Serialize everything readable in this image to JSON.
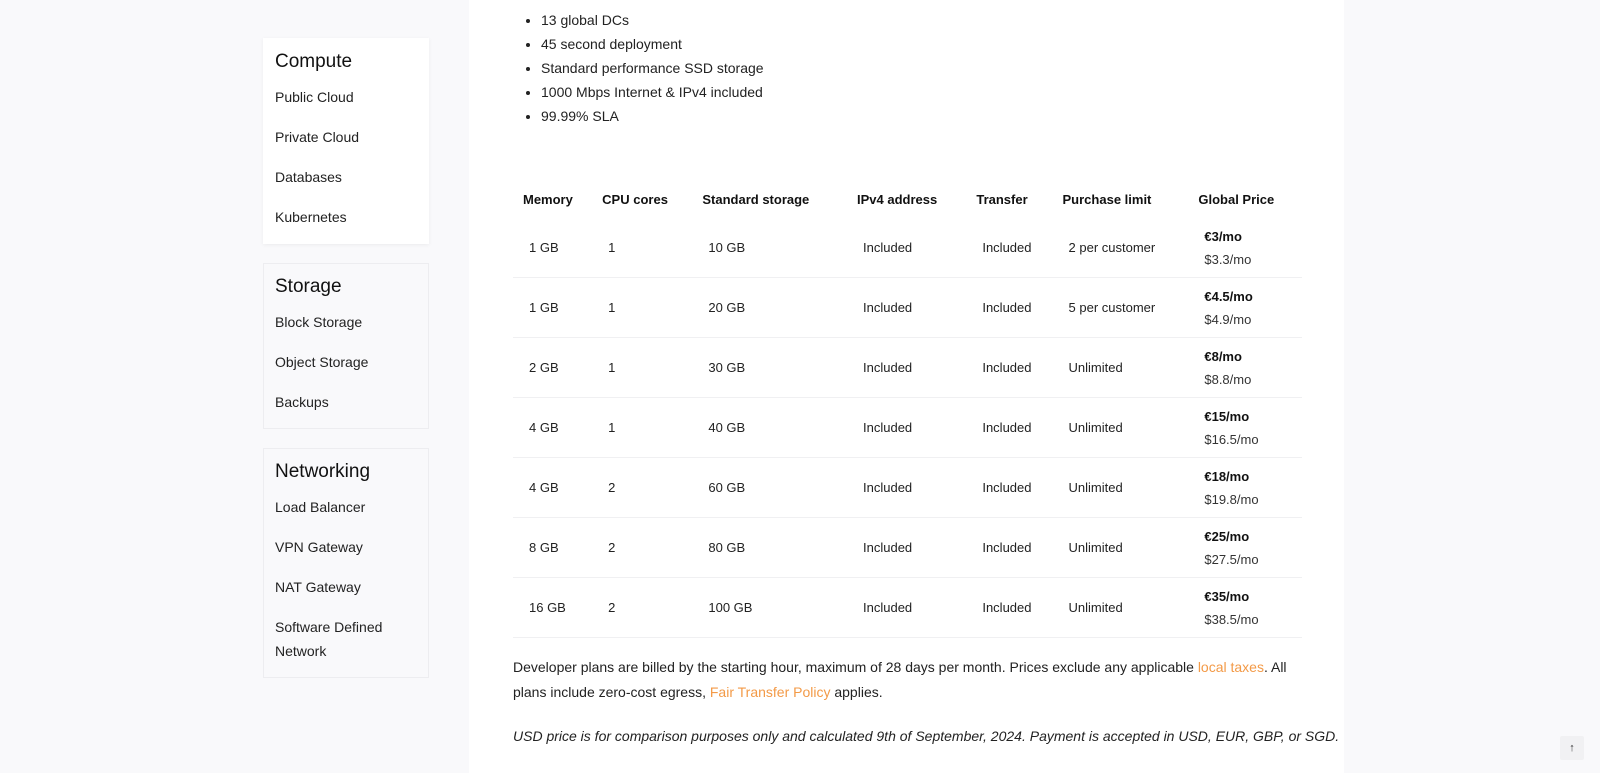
{
  "sidebar": {
    "groups": [
      {
        "title": "Compute",
        "active": true,
        "items": [
          "Public Cloud",
          "Private Cloud",
          "Databases",
          "Kubernetes"
        ]
      },
      {
        "title": "Storage",
        "active": false,
        "items": [
          "Block Storage",
          "Object Storage",
          "Backups"
        ]
      },
      {
        "title": "Networking",
        "active": false,
        "items": [
          "Load Balancer",
          "VPN Gateway",
          "NAT Gateway",
          "Software Defined Network"
        ]
      }
    ]
  },
  "features": [
    "13 global DCs",
    "45 second deployment",
    "Standard performance SSD storage",
    "1000 Mbps Internet & IPv4 included",
    "99.99% SLA"
  ],
  "table": {
    "headers": [
      "Memory",
      "CPU cores",
      "Standard storage",
      "IPv4 address",
      "Transfer",
      "Purchase limit",
      "Global Price"
    ],
    "rows": [
      {
        "memory": "1 GB",
        "cpu": "1",
        "storage": "10 GB",
        "ipv4": "Included",
        "transfer": "Included",
        "limit": "2 per customer",
        "eur": "€3/mo",
        "usd": "$3.3/mo"
      },
      {
        "memory": "1 GB",
        "cpu": "1",
        "storage": "20 GB",
        "ipv4": "Included",
        "transfer": "Included",
        "limit": "5 per customer",
        "eur": "€4.5/mo",
        "usd": "$4.9/mo"
      },
      {
        "memory": "2 GB",
        "cpu": "1",
        "storage": "30 GB",
        "ipv4": "Included",
        "transfer": "Included",
        "limit": "Unlimited",
        "eur": "€8/mo",
        "usd": "$8.8/mo"
      },
      {
        "memory": "4 GB",
        "cpu": "1",
        "storage": "40 GB",
        "ipv4": "Included",
        "transfer": "Included",
        "limit": "Unlimited",
        "eur": "€15/mo",
        "usd": "$16.5/mo"
      },
      {
        "memory": "4 GB",
        "cpu": "2",
        "storage": "60 GB",
        "ipv4": "Included",
        "transfer": "Included",
        "limit": "Unlimited",
        "eur": "€18/mo",
        "usd": "$19.8/mo"
      },
      {
        "memory": "8 GB",
        "cpu": "2",
        "storage": "80 GB",
        "ipv4": "Included",
        "transfer": "Included",
        "limit": "Unlimited",
        "eur": "€25/mo",
        "usd": "$27.5/mo"
      },
      {
        "memory": "16 GB",
        "cpu": "2",
        "storage": "100 GB",
        "ipv4": "Included",
        "transfer": "Included",
        "limit": "Unlimited",
        "eur": "€35/mo",
        "usd": "$38.5/mo"
      }
    ]
  },
  "note": {
    "part1": "Developer plans are billed by the starting hour, maximum of 28 days per month. Prices exclude any applicable ",
    "link1": "local taxes",
    "part2": ". All plans include zero-cost egress, ",
    "link2": "Fair Transfer Policy",
    "part3": " applies."
  },
  "disclaimer": "USD price is for comparison purposes only and calculated 9th of September, 2024. Payment is accepted in USD, EUR, GBP, or SGD.",
  "back_to_top": {
    "icon": "arrow-up-icon",
    "glyph": "↑"
  },
  "colors": {
    "link": "#f39a47",
    "page_bg": "#f9f9fb"
  }
}
